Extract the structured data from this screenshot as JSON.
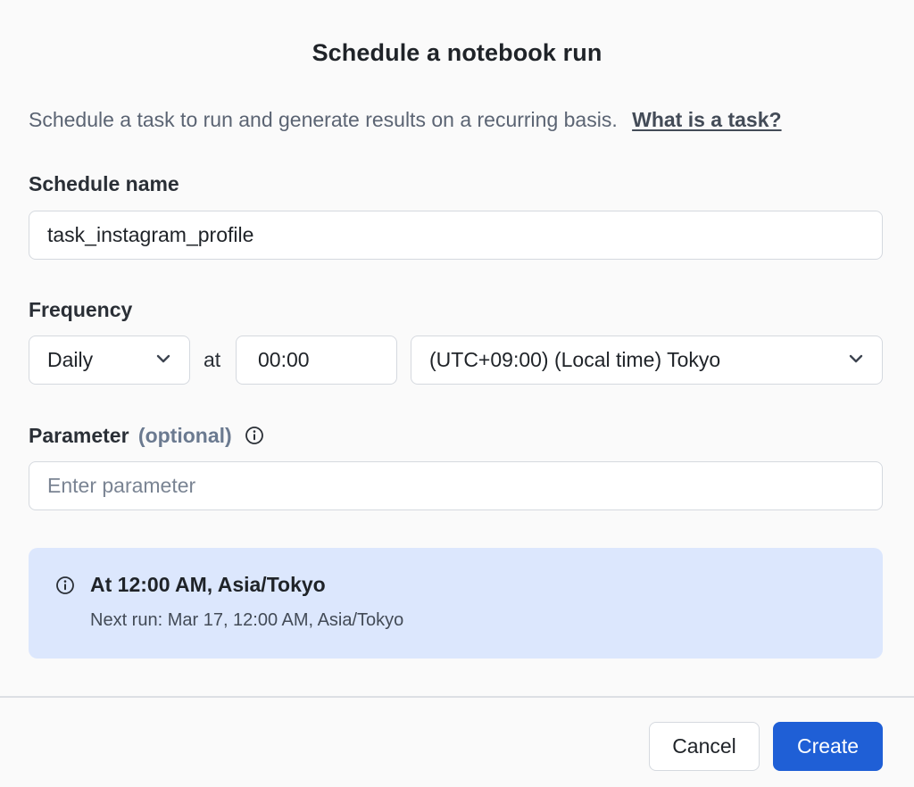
{
  "dialog": {
    "title": "Schedule a notebook run",
    "description": "Schedule a task to run and generate results on a recurring basis.",
    "help_link": "What is a task?"
  },
  "schedule_name": {
    "label": "Schedule name",
    "value": "task_instagram_profile"
  },
  "frequency": {
    "label": "Frequency",
    "interval_value": "Daily",
    "at_label": "at",
    "time_value": "00:00",
    "timezone_value": "(UTC+09:00) (Local time) Tokyo"
  },
  "parameter": {
    "label": "Parameter",
    "optional_label": "(optional)",
    "placeholder": "Enter parameter",
    "value": ""
  },
  "summary": {
    "title": "At 12:00 AM, Asia/Tokyo",
    "next_run": "Next run: Mar 17, 12:00 AM, Asia/Tokyo"
  },
  "footer": {
    "cancel_label": "Cancel",
    "create_label": "Create"
  },
  "colors": {
    "primary": "#1f5fd6",
    "info_bg": "#dce7fd"
  },
  "icons": {
    "dropdown": "chevron-down-icon",
    "info": "info-icon"
  }
}
